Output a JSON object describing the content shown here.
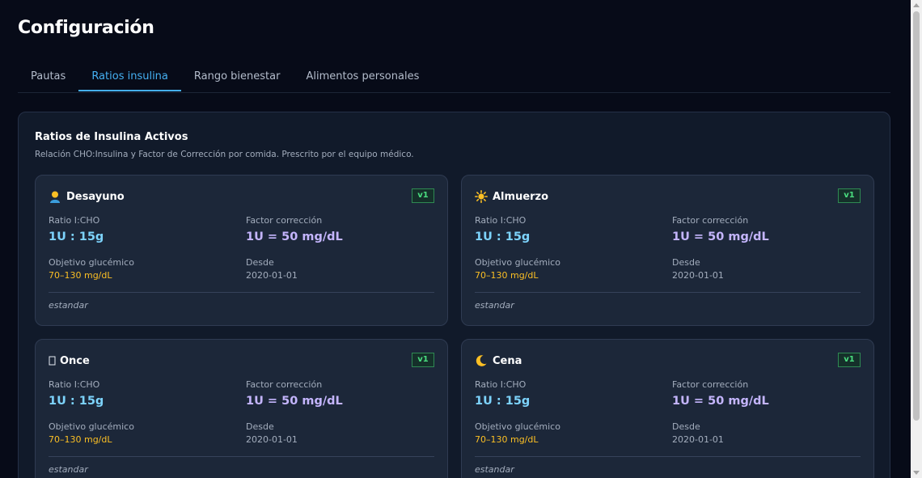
{
  "page": {
    "title": "Configuración"
  },
  "tabs": [
    {
      "label": "Pautas",
      "active": false
    },
    {
      "label": "Ratios insulina",
      "active": true
    },
    {
      "label": "Rango bienestar",
      "active": false
    },
    {
      "label": "Alimentos personales",
      "active": false
    }
  ],
  "panel": {
    "title": "Ratios de Insulina Activos",
    "subtitle": "Relación CHO:Insulina y Factor de Corrección por comida. Prescrito por el equipo médico."
  },
  "labels": {
    "ratio": "Ratio I:CHO",
    "factor": "Factor corrección",
    "target": "Objetivo glucémico",
    "since": "Desde"
  },
  "cards": [
    {
      "meal": "Desayuno",
      "icon": "person-icon",
      "version": "v1",
      "ratio": "1U : 15g",
      "factor": "1U = 50 mg/dL",
      "target": "70–130 mg/dL",
      "since": "2020-01-01",
      "note": "estandar"
    },
    {
      "meal": "Almuerzo",
      "icon": "sun-icon",
      "version": "v1",
      "ratio": "1U : 15g",
      "factor": "1U = 50 mg/dL",
      "target": "70–130 mg/dL",
      "since": "2020-01-01",
      "note": "estandar"
    },
    {
      "meal": "Once",
      "icon": "missing-glyph-icon",
      "version": "v1",
      "ratio": "1U : 15g",
      "factor": "1U = 50 mg/dL",
      "target": "70–130 mg/dL",
      "since": "2020-01-01",
      "note": "estandar"
    },
    {
      "meal": "Cena",
      "icon": "crescent-moon-icon",
      "version": "v1",
      "ratio": "1U : 15g",
      "factor": "1U = 50 mg/dL",
      "target": "70–130 mg/dL",
      "since": "2020-01-01",
      "note": "estandar"
    }
  ]
}
